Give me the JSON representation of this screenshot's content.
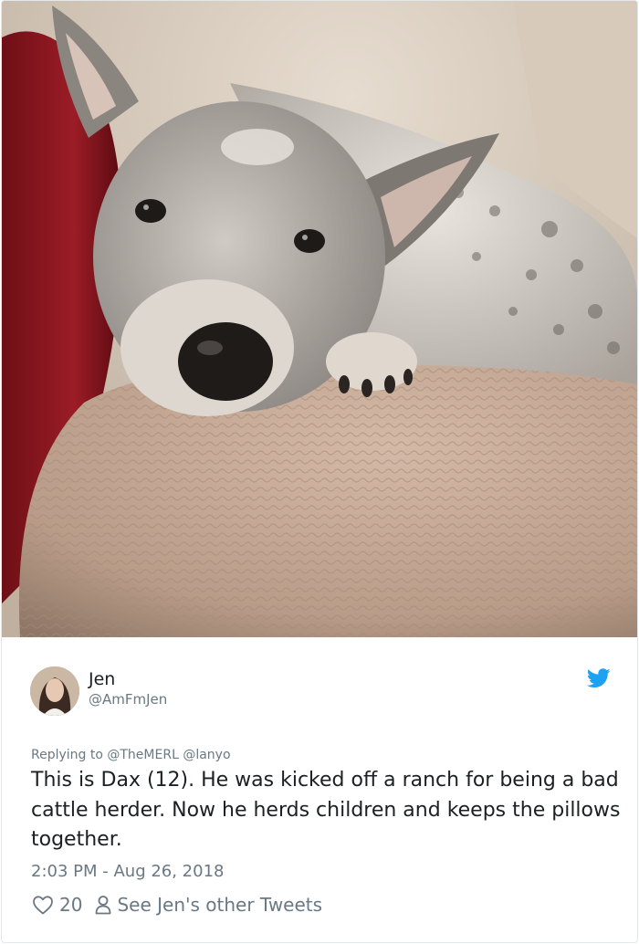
{
  "photo": {
    "alt_icon": "dog-photo"
  },
  "author": {
    "display_name": "Jen",
    "handle": "@AmFmJen",
    "avatar_icon": "avatar-photo"
  },
  "platform_icon": "twitter-bird-icon",
  "reply": {
    "replying_to": "Replying to @TheMERL @lanyo"
  },
  "tweet": {
    "text": "This is Dax (12). He was kicked off a ranch for being a bad cattle herder. Now he herds children and keeps the pillows together.",
    "timestamp": "2:03 PM - Aug 26, 2018"
  },
  "actions": {
    "like_count": "20",
    "profile_link": "See Jen's other Tweets"
  },
  "colors": {
    "twitter_blue": "#1da1f2",
    "text_primary": "#1c2022",
    "text_secondary": "#697882",
    "border": "#e1e8ed"
  }
}
